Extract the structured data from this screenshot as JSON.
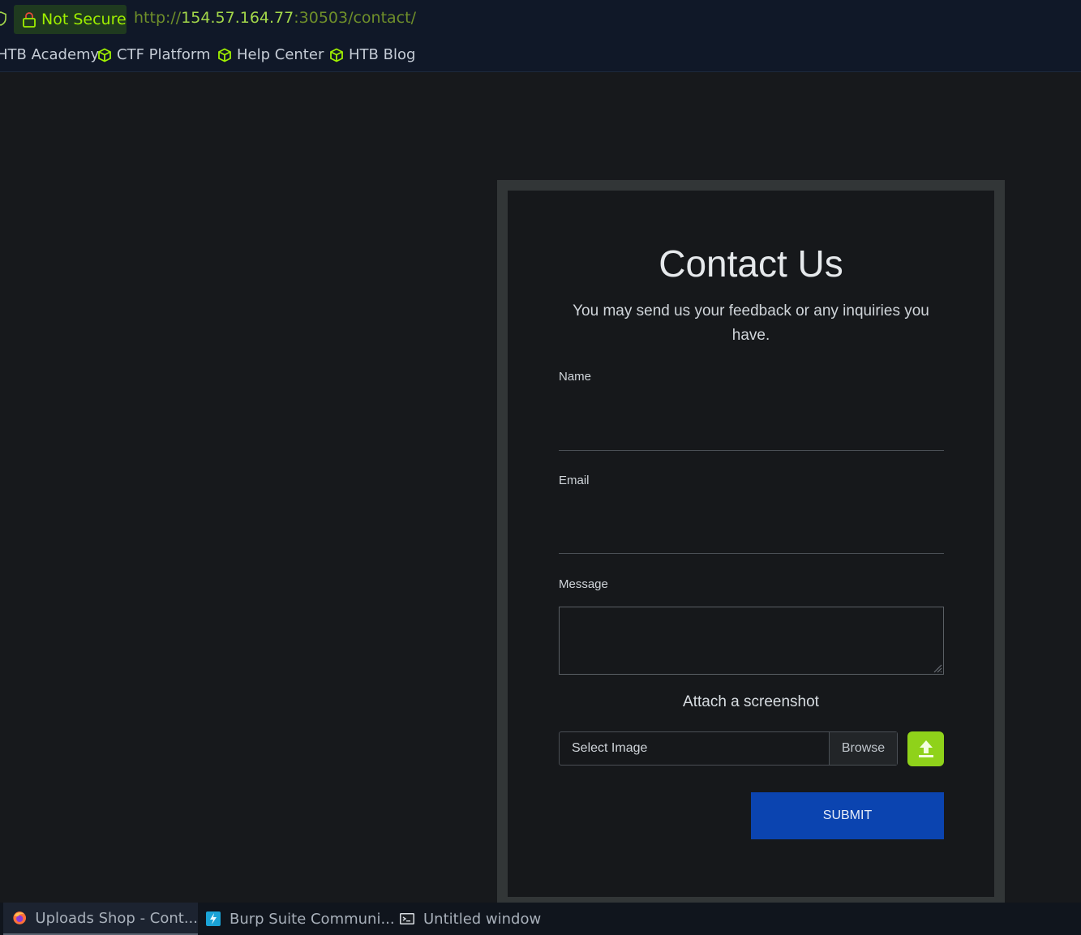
{
  "browser": {
    "security_label": "Not Secure",
    "url_scheme": "http://",
    "url_host": "154.57.164.77",
    "url_rest": ":30503/contact/",
    "bookmarks": [
      {
        "label": "HTB Academy"
      },
      {
        "label": "CTF Platform"
      },
      {
        "label": "Help Center"
      },
      {
        "label": "HTB Blog"
      }
    ],
    "accent_color": "#9fef00"
  },
  "form": {
    "title": "Contact Us",
    "subtitle": "You may send us your feedback or any inquiries you have.",
    "name_label": "Name",
    "email_label": "Email",
    "message_label": "Message",
    "attach_label": "Attach a screenshot",
    "file_placeholder": "Select Image",
    "browse_label": "Browse",
    "submit_label": "SUBMIT",
    "submit_color": "#0b44b0",
    "upload_color": "#8fd21a"
  },
  "taskbar": {
    "items": [
      {
        "label": "Uploads Shop - Cont...",
        "icon": "firefox-icon"
      },
      {
        "label": "Burp Suite Communi...",
        "icon": "burp-icon"
      },
      {
        "label": "Untitled window",
        "icon": "terminal-icon"
      }
    ]
  }
}
